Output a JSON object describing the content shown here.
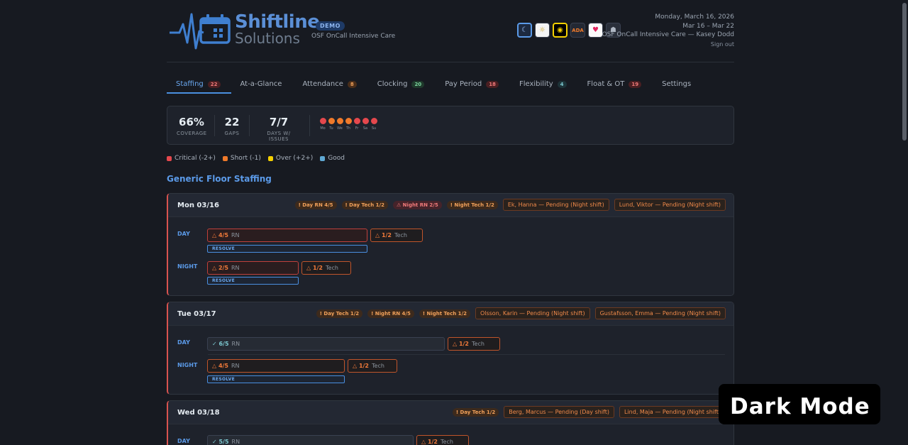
{
  "header": {
    "brand_line1": "Shiftline",
    "brand_line2": "Solutions",
    "demo_badge": "DEMO",
    "org": "OSF OnCall Intensive Care",
    "date": "Monday, March 16, 2026",
    "range": "Mar 16 – Mar 22",
    "user": "OSF OnCall Intensive Care — Kasey Dodd",
    "signout": "Sign out",
    "themes": [
      {
        "name": "dark-theme-icon",
        "glyph": "☾"
      },
      {
        "name": "light-theme-icon",
        "glyph": "☼"
      },
      {
        "name": "high-contrast-theme-icon",
        "glyph": "◉"
      },
      {
        "name": "ada-theme-icon",
        "glyph": "ADA"
      },
      {
        "name": "heart-theme-icon",
        "glyph": "♥"
      },
      {
        "name": "robot-theme-icon",
        "glyph": "☗"
      }
    ]
  },
  "tabs": [
    {
      "label": "Staffing",
      "count": "22",
      "color": "red"
    },
    {
      "label": "At-a-Glance",
      "count": "",
      "color": ""
    },
    {
      "label": "Attendance",
      "count": "8",
      "color": "orange"
    },
    {
      "label": "Clocking",
      "count": "20",
      "color": "green"
    },
    {
      "label": "Pay Period",
      "count": "18",
      "color": "red"
    },
    {
      "label": "Flexibility",
      "count": "4",
      "color": "teal"
    },
    {
      "label": "Float & OT",
      "count": "19",
      "color": "red"
    },
    {
      "label": "Settings",
      "count": "",
      "color": ""
    }
  ],
  "summary": {
    "coverage_value": "66%",
    "coverage_label": "COVERAGE",
    "gaps_value": "22",
    "gaps_label": "GAPS",
    "days_value": "7/7",
    "days_label": "DAYS W/ ISSUES",
    "week": [
      {
        "day": "Mo",
        "color": "#e5484d"
      },
      {
        "day": "Tu",
        "color": "#f07a2a"
      },
      {
        "day": "We",
        "color": "#f07a2a"
      },
      {
        "day": "Th",
        "color": "#f07a2a"
      },
      {
        "day": "Fr",
        "color": "#e5484d"
      },
      {
        "day": "Sa",
        "color": "#e5484d"
      },
      {
        "day": "Su",
        "color": "#e5484d"
      }
    ]
  },
  "legend": [
    {
      "label": "Critical (-2+)",
      "color": "#e5484d"
    },
    {
      "label": "Short (-1)",
      "color": "#f07a2a"
    },
    {
      "label": "Over (+2+)",
      "color": "#f5d000"
    },
    {
      "label": "Good",
      "color": "#5fa8d3"
    }
  ],
  "section_title": "Generic Floor Staffing",
  "resolve_label": "RESOLVE",
  "role_rn": "RN",
  "role_tech": "Tech",
  "shift_day": "DAY",
  "shift_night": "NIGHT",
  "days": [
    {
      "date": "Mon 03/16",
      "chips": [
        "! Day RN 4/5",
        "! Day Tech 1/2",
        "⚠ Night RN 2/5",
        "! Night Tech 1/2"
      ],
      "pending": [
        "Ek, Hanna — Pending (Night shift)",
        "Lund, Viktor — Pending (Night shift)"
      ],
      "day_rn": "△ 4/5",
      "day_tech": "△ 1/2",
      "night_rn": "△ 2/5",
      "night_tech": "△ 1/2"
    },
    {
      "date": "Tue 03/17",
      "chips": [
        "! Day Tech 1/2",
        "! Night RN 4/5",
        "! Night Tech 1/2"
      ],
      "pending": [
        "Olsson, Karin — Pending (Night shift)",
        "Gustafsson, Emma — Pending (Night shift)"
      ],
      "day_rn": "✓ 6/5",
      "day_tech": "△ 1/2",
      "night_rn": "△ 4/5",
      "night_tech": "△ 1/2"
    },
    {
      "date": "Wed 03/18",
      "chips": [
        "! Day Tech 1/2"
      ],
      "pending": [
        "Berg, Marcus — Pending (Day shift)",
        "Lind, Maja — Pending (Night shift)"
      ],
      "day_rn": "✓ 5/5",
      "day_tech": "△ 1/2"
    }
  ],
  "toast": "Dark Mode"
}
